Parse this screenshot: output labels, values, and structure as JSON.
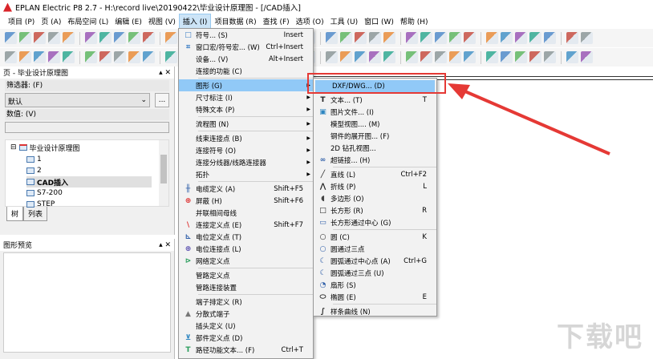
{
  "window": {
    "title": "EPLAN Electric P8 2.7 - H:\\record live\\20190422\\毕业设计原理图 - [/CAD插入]"
  },
  "menubar": [
    "项目 (P)",
    "页 (A)",
    "布局空间 (L)",
    "编辑 (E)",
    "视图 (V)",
    "插入 (I)",
    "项目数据 (R)",
    "查找 (F)",
    "选项 (O)",
    "工具 (U)",
    "窗口 (W)",
    "帮助 (H)"
  ],
  "active_menu": "插入 (I)",
  "pages_panel": {
    "title": "页 - 毕业设计原理图",
    "filter_label": "筛选器: (F)",
    "filter_value": "默认",
    "more_button": "...",
    "value_label": "数值: (V)",
    "value_input": "",
    "tree": {
      "root": "毕业设计原理图",
      "pages": [
        "1",
        "2",
        "CAD插入",
        "S7-200",
        "STEP"
      ],
      "selected": "CAD插入"
    },
    "tabs": [
      "树",
      "列表"
    ]
  },
  "preview_panel": {
    "title": "图形预览"
  },
  "insert_menu": [
    {
      "label": "符号... (S)",
      "shortcut": "Insert",
      "icon": "symbol-icon"
    },
    {
      "label": "窗口宏/符号宏... (W)",
      "shortcut": "Ctrl+Insert",
      "icon": "macro-icon"
    },
    {
      "label": "设备... (V)",
      "shortcut": "Alt+Insert"
    },
    {
      "label": "连接的功能 (C)"
    },
    {
      "sep": true
    },
    {
      "label": "图形 (G)",
      "submenu": true,
      "highlight": true
    },
    {
      "label": "尺寸标注 (I)",
      "submenu": true
    },
    {
      "label": "特殊文本 (P)",
      "submenu": true
    },
    {
      "sep": true
    },
    {
      "label": "流程图 (N)",
      "submenu": true
    },
    {
      "sep": true
    },
    {
      "label": "线束连接点 (B)",
      "submenu": true
    },
    {
      "label": "连接符号 (O)",
      "submenu": true
    },
    {
      "label": "连接分线器/线路连接器",
      "submenu": true
    },
    {
      "label": "拓扑",
      "submenu": true
    },
    {
      "sep": true
    },
    {
      "label": "电缆定义 (A)",
      "shortcut": "Shift+F5",
      "icon": "cable-icon"
    },
    {
      "label": "屏蔽 (H)",
      "shortcut": "Shift+F6",
      "icon": "shield-icon"
    },
    {
      "label": "并联相间母线"
    },
    {
      "label": "连接定义点 (E)",
      "shortcut": "Shift+F7",
      "icon": "connection-point-icon"
    },
    {
      "label": "电位定义点 (T)",
      "icon": "potential-point-icon"
    },
    {
      "label": "电位连接点 (L)",
      "icon": "potential-connection-icon"
    },
    {
      "label": "网络定义点",
      "icon": "network-point-icon"
    },
    {
      "sep": true
    },
    {
      "label": "管路定义点"
    },
    {
      "label": "管路连接装置"
    },
    {
      "sep": true
    },
    {
      "label": "端子排定义 (R)"
    },
    {
      "label": "分散式端子",
      "icon": "terminal-icon"
    },
    {
      "label": "插头定义 (U)"
    },
    {
      "label": "部件定义点 (D)",
      "icon": "cart-icon"
    },
    {
      "label": "路径功能文本... (F)",
      "shortcut": "Ctrl+T",
      "icon": "text-frame-icon"
    }
  ],
  "graphics_submenu": [
    {
      "label": "DXF/DWG... (D)",
      "highlight": true
    },
    {
      "label": "文本... (T)",
      "shortcut": "T",
      "icon": "text-icon"
    },
    {
      "label": "图片文件... (I)",
      "icon": "image-icon"
    },
    {
      "label": "模型视图.... (M)"
    },
    {
      "label": "钢件的展开图... (F)"
    },
    {
      "label": "2D 钻孔视图..."
    },
    {
      "label": "超链接... (H)",
      "icon": "link-icon"
    },
    {
      "sep": true
    },
    {
      "label": "直线 (L)",
      "shortcut": "Ctrl+F2",
      "icon": "line-icon"
    },
    {
      "label": "折线 (P)",
      "shortcut": "L",
      "icon": "polyline-icon"
    },
    {
      "label": "多边形 (O)",
      "icon": "polygon-icon"
    },
    {
      "label": "长方形 (R)",
      "shortcut": "R",
      "icon": "rectangle-icon"
    },
    {
      "label": "长方形通过中心 (G)",
      "icon": "rectangle-center-icon"
    },
    {
      "sep": true
    },
    {
      "label": "圆 (C)",
      "shortcut": "K",
      "icon": "circle-icon"
    },
    {
      "label": "圆通过三点",
      "icon": "circle-3pt-icon"
    },
    {
      "label": "圆弧通过中心点 (A)",
      "shortcut": "Ctrl+G",
      "icon": "arc-center-icon"
    },
    {
      "label": "圆弧通过三点 (U)",
      "icon": "arc-3pt-icon"
    },
    {
      "label": "扇形 (S)",
      "icon": "sector-icon"
    },
    {
      "label": "椭圆 (E)",
      "shortcut": "E",
      "icon": "ellipse-icon"
    },
    {
      "sep": true
    },
    {
      "label": "样条曲线 (N)",
      "icon": "spline-icon"
    }
  ],
  "colors": {
    "highlight": "#91c9f7",
    "annotation": "#e53935"
  },
  "watermark": "下载吧"
}
